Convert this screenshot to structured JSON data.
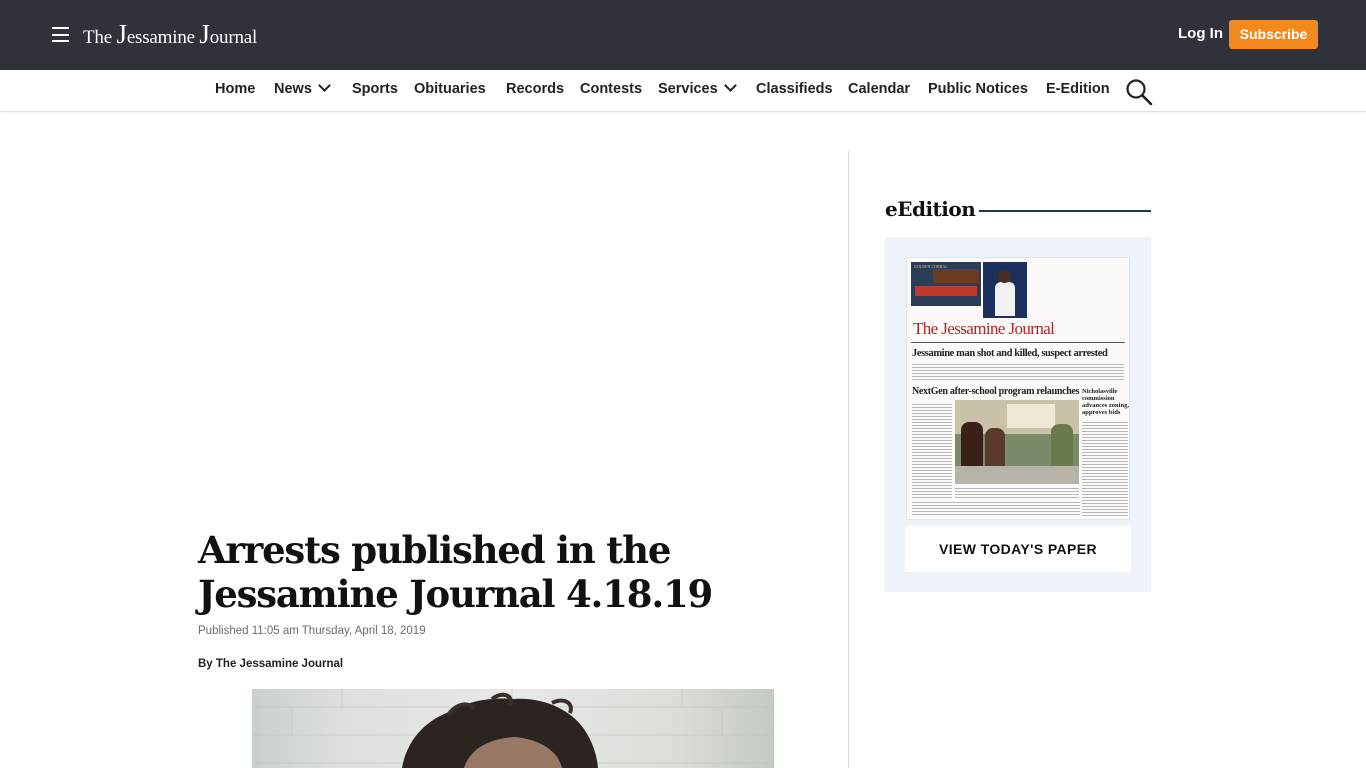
{
  "header": {
    "logo_small_1": "The ",
    "logo_big_1": "J",
    "logo_small_2": "essamine ",
    "logo_big_2": "J",
    "logo_small_3": "ournal",
    "login_label": "Log In",
    "subscribe_label": "Subscribe",
    "colors": {
      "bar": "#2f323b",
      "subscribe": "#f3891c"
    }
  },
  "nav": {
    "items": [
      "Home",
      "News",
      "Sports",
      "Obituaries",
      "Records",
      "Contests",
      "Services",
      "Classifieds",
      "Calendar",
      "Public Notices",
      "E-Edition"
    ],
    "dropdowns": [
      "News",
      "Services"
    ],
    "search_icon": "search-icon"
  },
  "article": {
    "headline": "Arrests published in the Jessamine Journal 4.18.19",
    "published": "Published 11:05 am Thursday, April 18, 2019",
    "byline_prefix": "By ",
    "byline_author": "The Jessamine Journal"
  },
  "sidebar": {
    "title": "eEdition",
    "button_label": "VIEW TODAY'S PAPER",
    "paper": {
      "masthead": "The Jessamine Journal",
      "headline_1": "Jessamine man shot and killed, suspect arrested",
      "headline_2": "NextGen after-school program relaunches",
      "headline_3": "Nicholasville commission advances zoning, approves bids",
      "ad_text": "GOLDEN CORRAL"
    },
    "colors": {
      "panel": "#eef3f9",
      "rule": "#1f3a4a"
    }
  }
}
